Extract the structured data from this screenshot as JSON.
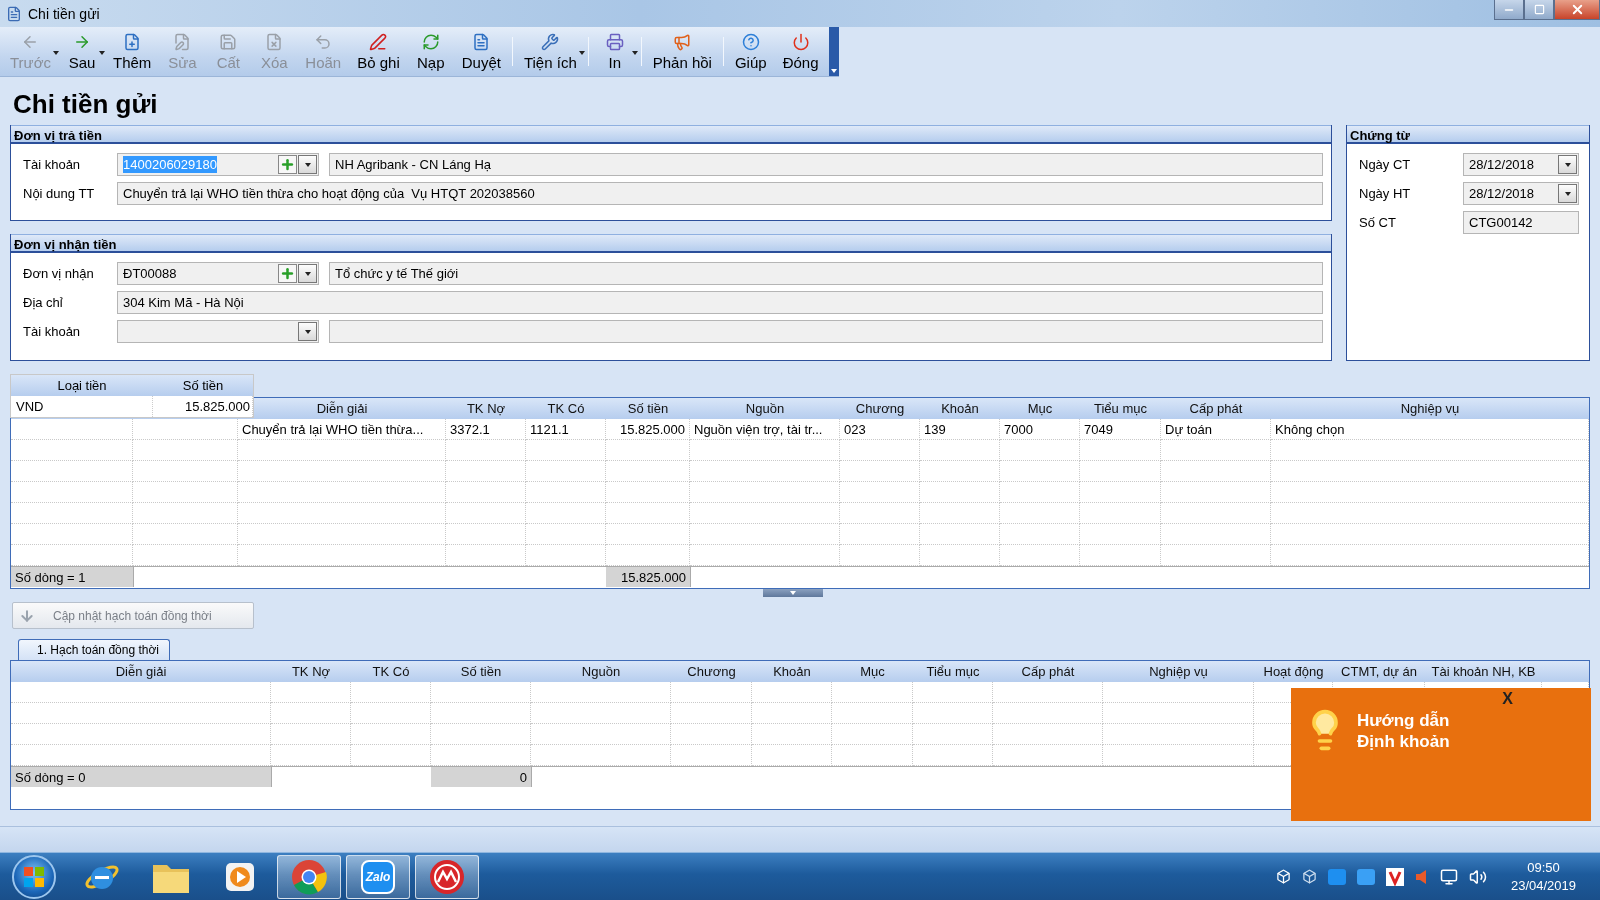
{
  "window": {
    "title": "Chi tiền gửi"
  },
  "toolbar": [
    {
      "label": "Trước",
      "disabled": true,
      "dropdown": true
    },
    {
      "label": "Sau",
      "disabled": false,
      "dropdown": true
    },
    {
      "label": "Thêm",
      "disabled": false
    },
    {
      "label": "Sửa",
      "disabled": true
    },
    {
      "label": "Cất",
      "disabled": true
    },
    {
      "label": "Xóa",
      "disabled": true
    },
    {
      "label": "Hoãn",
      "disabled": true
    },
    {
      "label": "Bỏ ghi",
      "disabled": false
    },
    {
      "label": "Nạp",
      "disabled": false
    },
    {
      "label": "Duyệt",
      "disabled": false
    },
    {
      "label": "Tiện ích",
      "disabled": false,
      "dropdown": true,
      "separator_before": true
    },
    {
      "label": "In",
      "disabled": false,
      "dropdown": true,
      "separator_before": true
    },
    {
      "label": "Phản hồi",
      "disabled": false,
      "separator_before": true
    },
    {
      "label": "Giúp",
      "disabled": false,
      "separator_before": true
    },
    {
      "label": "Đóng",
      "disabled": false
    }
  ],
  "page_title": "Chi tiền gửi",
  "payer": {
    "title": "Đơn vị trả tiền",
    "fields": [
      {
        "kind": "lookup",
        "label": "Tài khoản",
        "value": "1400206029180",
        "selected": true,
        "detail": "NH Agribank - CN Láng Hạ"
      },
      {
        "kind": "text",
        "label": "Nội dung TT",
        "value": "Chuyển trả lại WHO tiền thừa cho hoạt động của  Vụ HTQT 202038560"
      }
    ]
  },
  "payee": {
    "title": "Đơn vị nhận tiền",
    "fields": [
      {
        "kind": "lookup",
        "label": "Đơn vị nhận",
        "value": "ĐT00088",
        "selected": false,
        "detail": "Tổ chức y tế Thế giới"
      },
      {
        "kind": "text",
        "label": "Địa chỉ",
        "value": "304 Kim Mã - Hà Nội"
      },
      {
        "kind": "combo",
        "label": "Tài khoản"
      }
    ]
  },
  "voucher": {
    "title": "Chứng từ",
    "fields": [
      {
        "kind": "date",
        "label": "Ngày CT",
        "value": "28/12/2018"
      },
      {
        "kind": "date",
        "label": "Ngày HT",
        "value": "28/12/2018"
      },
      {
        "kind": "text",
        "label": "Số CT",
        "value": "CTG00142"
      }
    ]
  },
  "currency_table": {
    "columns": [
      "Loại tiền",
      "Số tiền"
    ],
    "rows": [
      {
        "cells": [
          "VND",
          "15.825.000"
        ]
      }
    ]
  },
  "lines_table": {
    "columns": [
      {
        "kind": "blank"
      },
      {
        "kind": "blank"
      },
      {
        "kind": "text",
        "label": "Diễn giải"
      },
      {
        "kind": "text",
        "label": "TK Nợ"
      },
      {
        "kind": "text",
        "label": "TK Có"
      },
      {
        "kind": "amount",
        "label": "Số tiền"
      },
      {
        "kind": "text",
        "label": "Nguồn"
      },
      {
        "kind": "text",
        "label": "Chương"
      },
      {
        "kind": "text",
        "label": "Khoản"
      },
      {
        "kind": "text",
        "label": "Mục"
      },
      {
        "kind": "text",
        "label": "Tiểu mục"
      },
      {
        "kind": "text",
        "label": "Cấp phát"
      },
      {
        "kind": "text",
        "label": "Nghiệp vụ"
      }
    ],
    "rows": [
      {
        "cells": [
          "",
          "",
          "Chuyển trả lại WHO tiền thừa...",
          "3372.1",
          "1121.1",
          "15.825.000",
          "Nguồn viện trợ, tài tr...",
          "023",
          "139",
          "7000",
          "7049",
          "Dự toán",
          "Không chọn"
        ]
      }
    ],
    "footer": {
      "count": "Số dòng = 1",
      "total": "15.825.000"
    }
  },
  "update_button": {
    "label": "Cập nhật hạch toán đồng thời",
    "disabled": true
  },
  "tabs": [
    {
      "label": "1. Hạch toán đồng thời",
      "selected": true
    }
  ],
  "journal_table": {
    "columns": [
      {
        "label": "Diễn giải"
      },
      {
        "label": "TK Nợ"
      },
      {
        "label": "TK Có"
      },
      {
        "kind": "amount",
        "label": "Số tiền"
      },
      {
        "label": "Nguồn"
      },
      {
        "label": "Chương"
      },
      {
        "label": "Khoản"
      },
      {
        "label": "Mục"
      },
      {
        "label": "Tiểu mục"
      },
      {
        "label": "Cấp phát"
      },
      {
        "label": "Nghiệp vụ"
      },
      {
        "label": "Hoạt động"
      },
      {
        "label": "CTMT, dự án"
      },
      {
        "label": "Tài khoản NH, KB"
      }
    ],
    "footer": {
      "count": "Số dòng = 0",
      "total": "0"
    }
  },
  "tip": {
    "lines": [
      "Hướng dẫn",
      "Định khoản"
    ],
    "close": "X"
  },
  "taskbar": {
    "apps": [
      {
        "active": false
      },
      {
        "active": false
      },
      {
        "active": false
      },
      {
        "active": true
      },
      {
        "active": true,
        "label": "Zalo"
      },
      {
        "active": true
      }
    ],
    "time": "09:50",
    "date": "23/04/2019"
  }
}
